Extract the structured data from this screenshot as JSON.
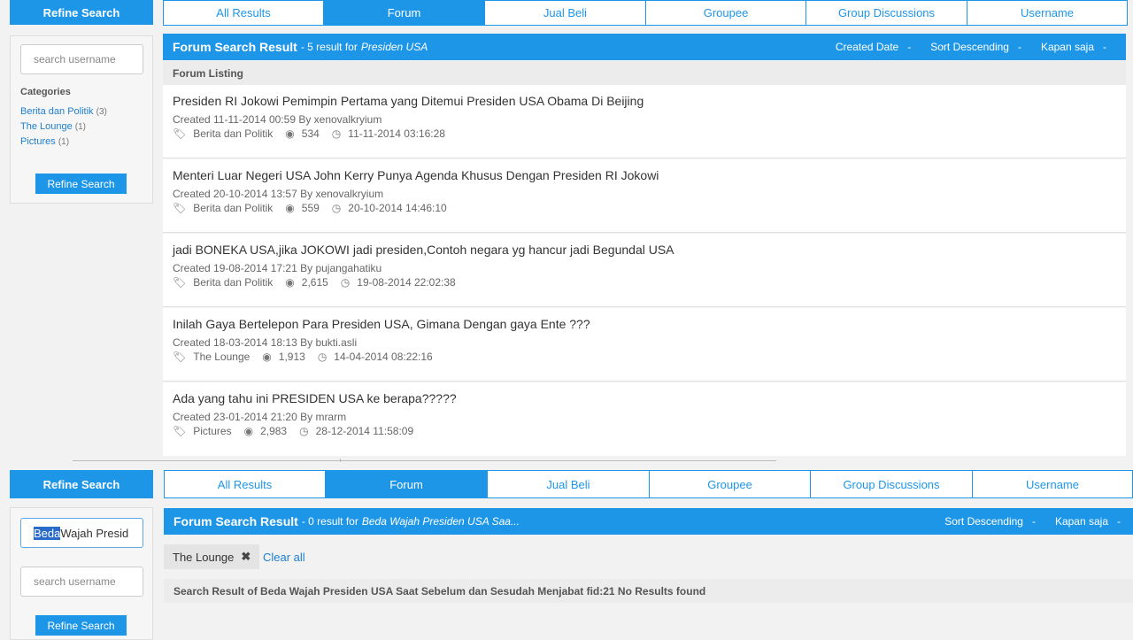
{
  "top": {
    "refine_title": "Refine Search",
    "search_placeholder": "search username",
    "categories_title": "Categories",
    "categories": [
      {
        "label": "Berita dan Politik",
        "count": "(3)"
      },
      {
        "label": "The Lounge",
        "count": "(1)"
      },
      {
        "label": "Pictures",
        "count": "(1)"
      }
    ],
    "refine_button": "Refine Search",
    "tabs": [
      "All Results",
      "Forum",
      "Jual Beli",
      "Groupee",
      "Group Discussions",
      "Username"
    ],
    "active_tab": "Forum",
    "result_title": "Forum Search Result",
    "result_summary": "- 5 result for",
    "result_query": "Presiden USA",
    "sort_options": [
      "Created Date",
      "Sort Descending",
      "Kapan saja"
    ],
    "listing_header": "Forum Listing",
    "threads": [
      {
        "title": "Presiden RI Jokowi Pemimpin Pertama yang Ditemui Presiden USA Obama Di Beijing",
        "created": "Created 11-11-2014 00:59 By xenovalkryium",
        "category": "Berita dan Politik",
        "views": "534",
        "last": "11-11-2014 03:16:28"
      },
      {
        "title": "Menteri Luar Negeri USA John Kerry Punya Agenda Khusus Dengan Presiden RI Jokowi",
        "created": "Created 20-10-2014 13:57 By xenovalkryium",
        "category": "Berita dan Politik",
        "views": "559",
        "last": "20-10-2014 14:46:10"
      },
      {
        "title": "jadi BONEKA USA,jika JOKOWI jadi presiden,Contoh negara yg hancur jadi Begundal USA",
        "created": "Created 19-08-2014 17:21 By pujangahatiku",
        "category": "Berita dan Politik",
        "views": "2,615",
        "last": "19-08-2014 22:02:38"
      },
      {
        "title": "Inilah Gaya Bertelepon Para Presiden USA, Gimana Dengan gaya Ente ???",
        "created": "Created 18-03-2014 18:13 By bukti.asli",
        "category": "The Lounge",
        "views": "1,913",
        "last": "14-04-2014 08:22:16"
      },
      {
        "title": "Ada yang tahu ini PRESIDEN USA ke berapa?????",
        "created": "Created 23-01-2014 21:20 By mrarm",
        "category": "Pictures",
        "views": "2,983",
        "last": "28-12-2014 11:58:09"
      }
    ]
  },
  "bottom": {
    "refine_title": "Refine Search",
    "keyword_selected": "Beda",
    "keyword_rest": " Wajah Presid",
    "search_placeholder": "search username",
    "refine_button": "Refine Search",
    "tabs": [
      "All Results",
      "Forum",
      "Jual Beli",
      "Groupee",
      "Group Discussions",
      "Username"
    ],
    "active_tab": "Forum",
    "result_title": "Forum Search Result",
    "result_summary": "- 0 result for",
    "result_query": "Beda Wajah Presiden USA Saa...",
    "sort_options": [
      "Sort Descending",
      "Kapan saja"
    ],
    "filter_chip": "The Lounge",
    "clear_all": "Clear all",
    "no_result_text": "Search Result of Beda Wajah Presiden USA Saat Sebelum dan Sesudah Menjabat fid:21 No Results found"
  },
  "icons": {
    "tag": "tag-icon",
    "views": "eye-icon",
    "time": "clock-icon",
    "remove": "close-icon"
  },
  "colors": {
    "accent": "#1e96e8",
    "link": "#1e7fd0"
  }
}
